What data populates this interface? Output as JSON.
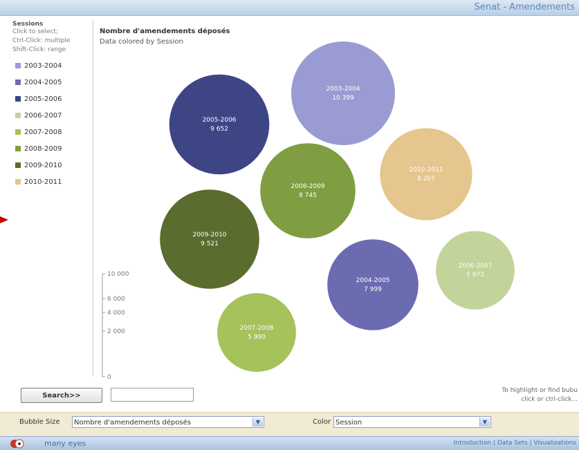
{
  "window": {
    "title": "Senat - Amendements"
  },
  "legend": {
    "title": "Sessions",
    "hints": [
      "Click to select;",
      "Ctrl-Click: multiple",
      "Shift-Click: range"
    ]
  },
  "chart_data": {
    "type": "bubble",
    "title": "Nombre d'amendements déposés",
    "subtitle": "Data colored by Session",
    "size_axis": {
      "ticks": [
        "10 000",
        "6 000",
        "4 000",
        "2 000",
        "0"
      ]
    },
    "series": [
      {
        "name": "2003-2004",
        "color": "#9b9bd4",
        "value": 10399,
        "label": "10 399"
      },
      {
        "name": "2004-2005",
        "color": "#6b6bb2",
        "value": 7999,
        "label": "7 999"
      },
      {
        "name": "2005-2006",
        "color": "#3e4585",
        "value": 9652,
        "label": "9 652"
      },
      {
        "name": "2006-2007",
        "color": "#c2d49a",
        "value": 5973,
        "label": "5 973"
      },
      {
        "name": "2007-2008",
        "color": "#a6c25a",
        "value": 5990,
        "label": "5 990"
      },
      {
        "name": "2008-2009",
        "color": "#7f9e42",
        "value": 8745,
        "label": "8 745"
      },
      {
        "name": "2009-2010",
        "color": "#5a6c2e",
        "value": 9521,
        "label": "9 521"
      },
      {
        "name": "2010-2011",
        "color": "#e4c68e",
        "value": 8207,
        "label": "8 207"
      }
    ]
  },
  "search": {
    "button_label": "Search>>",
    "input_value": ""
  },
  "hint": {
    "line1": "To highlight or find bubu",
    "line2": "click or ctrl-click..."
  },
  "controls": {
    "size_label": "Bubble Size",
    "size_value": "Nombre d'amendements déposés",
    "color_label": "Color",
    "color_value": "Session"
  },
  "footer": {
    "brand": "many eyes",
    "links": "Introduction | Data Sets | Visualizations"
  }
}
